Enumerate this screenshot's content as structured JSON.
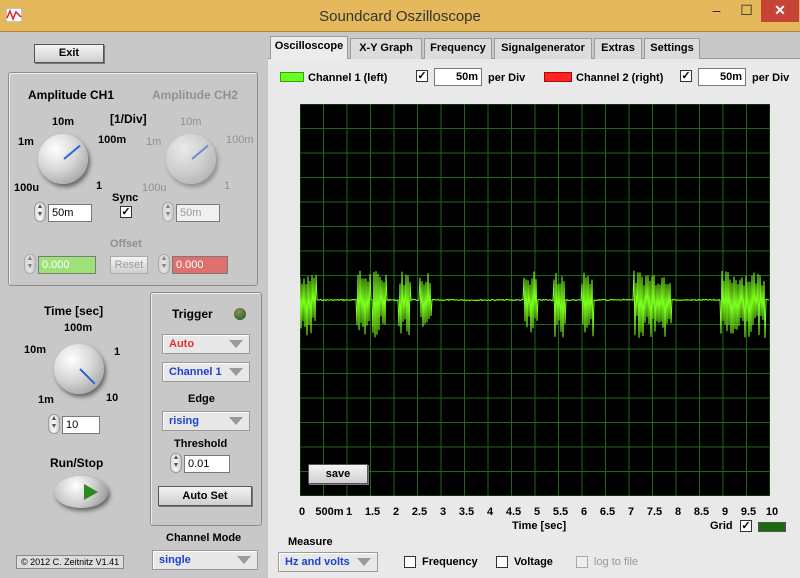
{
  "window": {
    "title": "Soundcard Oszilloscope",
    "min": "–",
    "max": "☐",
    "close": "✕"
  },
  "left": {
    "exit": "Exit",
    "amp_ch1_title": "Amplitude CH1",
    "amp_ch2_title": "Amplitude CH2",
    "div_unit": "[1/Div]",
    "ch1_scale": [
      "10m",
      "100m",
      "1m",
      "100u",
      "1"
    ],
    "ch2_scale": [
      "10m",
      "100m",
      "1m",
      "100u",
      "1"
    ],
    "ch1_value": "50m",
    "ch2_value": "50m",
    "sync_label": "Sync",
    "sync_checked": "✓",
    "offset_label": "Offset",
    "offset_ch1": "0.000",
    "offset_ch2": "0.000",
    "reset": "Reset",
    "time_title": "Time [sec]",
    "time_scale": [
      "100m",
      "10m",
      "1",
      "1m",
      "10"
    ],
    "time_value": "10",
    "runstop": "Run/Stop",
    "copyright": "© 2012  C. Zeitnitz V1.41"
  },
  "trigger": {
    "title": "Trigger",
    "mode": "Auto",
    "channel": "Channel 1",
    "edge_label": "Edge",
    "edge": "rising",
    "threshold_label": "Threshold",
    "threshold": "0.01",
    "autoset": "Auto Set",
    "channel_mode_label": "Channel Mode",
    "channel_mode": "single"
  },
  "tabs": [
    "Oscilloscope",
    "X-Y Graph",
    "Frequency",
    "Signalgenerator",
    "Extras",
    "Settings"
  ],
  "channels": {
    "ch1_label": "Channel 1 (left)",
    "ch2_label": "Channel 2 (right)",
    "ch1_checked": "✓",
    "ch2_checked": "✓",
    "ch1_perdiv": "50m",
    "ch2_perdiv": "50m",
    "per_div": "per Div",
    "ch1_color": "#66ff22",
    "ch2_color": "#ff2222"
  },
  "scope": {
    "save": "save",
    "x_ticks": [
      "0",
      "500m",
      "1",
      "1.5",
      "2",
      "2.5",
      "3",
      "3.5",
      "4",
      "4.5",
      "5",
      "5.5",
      "6",
      "6.5",
      "7",
      "7.5",
      "8",
      "8.5",
      "9",
      "9.5",
      "10"
    ],
    "x_label": "Time [sec]",
    "grid_label": "Grid",
    "grid_checked": "✓",
    "trace_color": "#7cff1c"
  },
  "measure": {
    "label": "Measure",
    "mode": "Hz and volts",
    "frequency": "Frequency",
    "voltage": "Voltage",
    "log": "log to file"
  }
}
